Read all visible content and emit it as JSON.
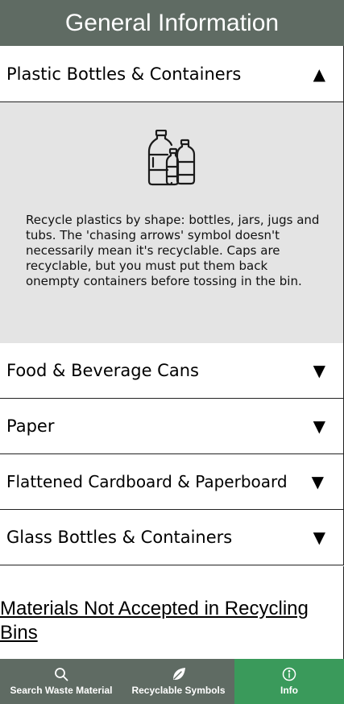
{
  "header": {
    "title": "General Information"
  },
  "accordion": {
    "expanded": {
      "label": "Plastic Bottles & Containers",
      "arrow": "▲",
      "icon": "plastic-bottles-icon",
      "description": "Recycle plastics by shape: bottles, jars, jugs and tubs. The 'chasing arrows' symbol doesn't necessarily mean it's recyclable. Caps are recyclable, but you must put them back onempty containers before tossing in the bin."
    },
    "collapsed": [
      {
        "label": "Food & Beverage Cans",
        "arrow": "▼"
      },
      {
        "label": "Paper",
        "arrow": "▼"
      },
      {
        "label": "Flattened Cardboard & Paperboard",
        "arrow": "▼"
      },
      {
        "label": "Glass Bottles & Containers",
        "arrow": "▼"
      }
    ]
  },
  "link": {
    "text": "Materials Not Accepted in Recycling Bins"
  },
  "tabbar": {
    "tabs": [
      {
        "label": "Search Waste Material",
        "icon": "search-icon",
        "active": false
      },
      {
        "label": "Recyclable Symbols",
        "icon": "leaf-icon",
        "active": false
      },
      {
        "label": "Info",
        "icon": "info-icon",
        "active": true
      }
    ],
    "colors": {
      "bar": "#5f6b63",
      "active": "#3a9a5b"
    }
  }
}
